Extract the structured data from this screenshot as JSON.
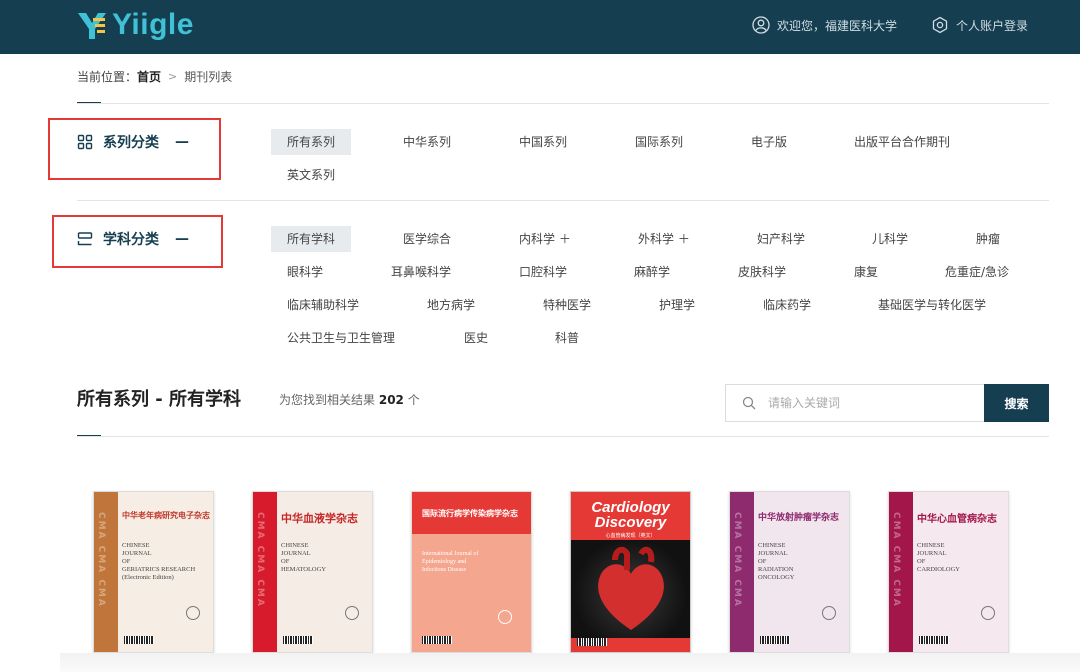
{
  "header": {
    "logo_text": "Yiigle",
    "welcome": "欢迎您，福建医科大学",
    "login": "个人账户登录"
  },
  "breadcrumb": {
    "prefix": "当前位置：",
    "home": "首页",
    "current": "期刊列表"
  },
  "series": {
    "title": "系列分类",
    "toggle": "—",
    "filters": [
      "所有系列",
      "中华系列",
      "中国系列",
      "国际系列",
      "电子版",
      "出版平台合作期刊",
      "英文系列"
    ],
    "active": "所有系列"
  },
  "subjects": {
    "title": "学科分类",
    "toggle": "—",
    "filters": [
      "所有学科",
      "医学综合",
      "内科学 ＋",
      "外科学 ＋",
      "妇产科学",
      "儿科学",
      "肿瘤",
      "眼科学",
      "耳鼻喉科学",
      "口腔科学",
      "麻醉学",
      "皮肤科学",
      "康复",
      "危重症/急诊",
      "临床辅助科学",
      "地方病学",
      "特种医学",
      "护理学",
      "临床药学",
      "基础医学与转化医学",
      "公共卫生与卫生管理",
      "医史",
      "科普"
    ],
    "active": "所有学科"
  },
  "results": {
    "title": "所有系列 - 所有学科",
    "count_prefix": "为您找到相关结果",
    "count": "202",
    "count_suffix": "个"
  },
  "search": {
    "placeholder": "请输入关键词",
    "button": "搜索"
  },
  "journals": [
    {
      "cn": "中华老年病研究电子杂志",
      "en": "CHINESE\nJOURNAL\nOF\nGERIATRICS RESEARCH\n(Electronic Edition)",
      "strip_color": "#c0763a",
      "bg": "#f6ede4",
      "title_color": "#c0392b",
      "strip_text": "CMA CMA CMA"
    },
    {
      "cn": "中华血液学杂志",
      "en": "CHINESE\nJOURNAL\nOF\nHEMATOLOGY",
      "strip_color": "#d81b2c",
      "bg": "#f5ece6",
      "title_color": "#c62828",
      "strip_text": "CMA CMA CMA"
    },
    {
      "cn": "国际流行病学传染病学杂志",
      "en": "International Journal of\nEpidemiology and\nInfectious Disease",
      "strip_color": "#e53935",
      "bg": "#f4a68f",
      "title_color": "#ffffff",
      "strip_text": ""
    },
    {
      "cn": "Cardiology Discovery",
      "sub": "心血管病发现（英文）"
    },
    {
      "cn": "中华放射肿瘤学杂志",
      "en": "CHINESE\nJOURNAL\nOF\nRADIATION\nONCOLOGY",
      "strip_color": "#8e2a6e",
      "bg": "#f1e6ee",
      "title_color": "#8e2a6e",
      "strip_text": "CMA CMA CMA"
    },
    {
      "cn": "中华心血管病杂志",
      "en": "CHINESE\nJOURNAL\nOF\nCARDIOLOGY",
      "strip_color": "#a3164a",
      "bg": "#f5e9ef",
      "title_color": "#a3164a",
      "strip_text": "CMA CMA CMA"
    }
  ],
  "colors": {
    "header_bg": "#163e51",
    "accent": "#3fc1d6",
    "highlight": "#e53935"
  }
}
